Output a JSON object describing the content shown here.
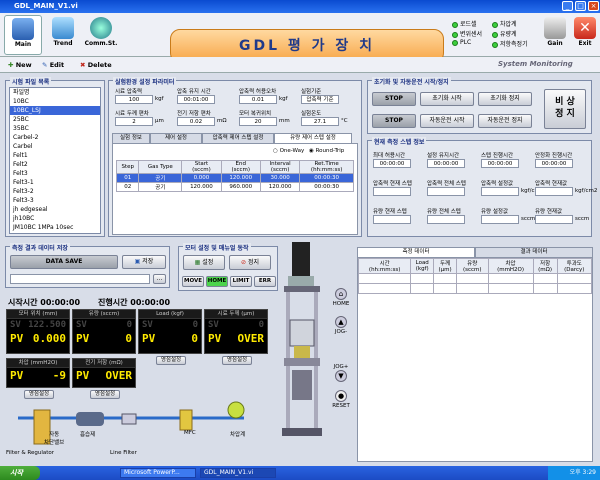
{
  "window": {
    "title": "GDL_MAIN_V1.vi"
  },
  "toolbar": {
    "main": "Main",
    "trend": "Trend",
    "comm": "Comm.St.",
    "gain": "Gain",
    "exit": "Exit",
    "banner": "GDL 평 가 장 치",
    "leds": [
      "로드셀",
      "변위센서",
      "PLC",
      "차압계",
      "유량계",
      "저항측정기"
    ]
  },
  "actions": {
    "new": "New",
    "edit": "Edit",
    "delete": "Delete",
    "system_monitoring": "System Monitoring"
  },
  "sample_list": {
    "title": "시험 파일 목록",
    "items": [
      "파일명",
      "10BC",
      "10BC_LSJ",
      "25BC",
      "35BC",
      "Carbel-2",
      "Carbel",
      "Felt1",
      "Felt2",
      "Felt3",
      "Felt3-1",
      "Felt3-2",
      "Felt3-3",
      "jh edgeseal",
      "jh10BC",
      "JM10BC 1MPa 10sec"
    ],
    "selected": 2
  },
  "params": {
    "title": "실험환경 설정 파라미터",
    "row1": [
      {
        "label": "시료 압축력",
        "value": "100",
        "unit": "kgf"
      },
      {
        "label": "압축 유지 시간",
        "value": "00:01:00",
        "unit": ""
      },
      {
        "label": "압축력 허용오차",
        "value": "0.01",
        "unit": "kgf"
      },
      {
        "label": "실험기준",
        "value": "압축력 기준",
        "unit": ""
      }
    ],
    "row2": [
      {
        "label": "시료 두께 편차",
        "value": "2",
        "unit": "μm"
      },
      {
        "label": "전기 저항 편차",
        "value": "0.02",
        "unit": "mΩ"
      },
      {
        "label": "모터 복귀위치",
        "value": "20",
        "unit": "mm"
      },
      {
        "label": "실험온도",
        "value": "27.1",
        "unit": "°C"
      }
    ],
    "tabs": [
      "실험 정보",
      "제어 설정",
      "압축력 제어 스텝 설정",
      "유량 제어 스텝 설정"
    ],
    "radio": [
      "One-Way",
      "Round-Trip"
    ],
    "columns": [
      "Step",
      "Gas Type",
      "Start\n(sccm)",
      "End\n(sccm)",
      "Interval\n(sccm)",
      "Ret.Time\n(hh:mm:ss)"
    ],
    "rows": [
      [
        "01",
        "공기",
        "0.000",
        "120.000",
        "30.000",
        "00:00:30"
      ],
      [
        "02",
        "공기",
        "120.000",
        "960.000",
        "120.000",
        "00:00:30"
      ]
    ]
  },
  "control": {
    "title": "초기화 및 자동운전 시작/정지",
    "stop": "STOP",
    "init_start": "초기화 시작",
    "init_stop": "초기화 정지",
    "auto_start": "자동운전 시작",
    "auto_stop": "자동운전 정지",
    "emergency": "비 상\n정 지"
  },
  "status": {
    "title": "현재 측정 스텝 정보",
    "row1": [
      {
        "label": "최대 허용시간",
        "value": "00:00:00"
      },
      {
        "label": "설정 유지시간",
        "value": "00:00:00"
      },
      {
        "label": "스텝 진행시간",
        "value": "00:00:00"
      },
      {
        "label": "안정화 진행시간",
        "value": "00:00:00"
      }
    ],
    "row2": [
      {
        "label": "압축력 현재 스텝"
      },
      {
        "label": "압축력 전체 스텝"
      },
      {
        "label": "압축력 설정값",
        "unit": "kgf/cm2"
      },
      {
        "label": "압축력 현재값",
        "unit": "kgf/cm2"
      }
    ],
    "row3": [
      {
        "label": "유량 현재 스텝"
      },
      {
        "label": "유량 전체 스텝"
      },
      {
        "label": "유량 설정값",
        "unit": "sccm"
      },
      {
        "label": "유량 현재값",
        "unit": "sccm"
      }
    ]
  },
  "save": {
    "title": "측정 결과 데이터 저장",
    "data_save": "DATA SAVE",
    "store": "저장",
    "browse": "..."
  },
  "motor": {
    "title": "모터 설정 및 매뉴얼 동작",
    "set": "설정",
    "stop": "정지",
    "modes": [
      "MOVE",
      "HOME",
      "LIMIT",
      "ERR"
    ]
  },
  "manual": {
    "home": "HOME",
    "jog_minus": "JOG-",
    "jog_plus": "JOG+",
    "reset": "RESET"
  },
  "timers": {
    "start_label": "시작시간",
    "start": "00:00:00",
    "elapsed_label": "진행시간",
    "elapsed": "00:00:00"
  },
  "meters": [
    {
      "title": "모터 위치 (mm)",
      "sv_label": "SV",
      "sv": "122.500",
      "pv_label": "PV",
      "pv": "0.000"
    },
    {
      "title": "유량 (sccm)",
      "sv_label": "SV",
      "sv": "0",
      "pv_label": "PV",
      "pv": "0"
    },
    {
      "title": "Load (kgf)",
      "sv_label": "SV",
      "sv": "0",
      "pv_label": "PV",
      "pv": "0",
      "btn": "영점설정"
    },
    {
      "title": "시료 두께 (μm)",
      "sv_label": "SV",
      "sv": "0",
      "pv_label": "PV",
      "pv": "OVER",
      "btn": "영점설정"
    },
    {
      "title": "차압 (mmH2O)",
      "pv_label": "PV",
      "pv": "-9",
      "btn": "영점설정"
    },
    {
      "title": "전기 저항 (mΩ)",
      "pv_label": "PV",
      "pv": "OVER",
      "btn": "영점설정"
    }
  ],
  "schematic": {
    "filter": "Filter & Regulator",
    "valve": "자동\n차단밸브",
    "tank": "흡습제",
    "linefilter": "Line Filter",
    "mfc": "MFC",
    "gauge": "차압계"
  },
  "data_tabs": [
    "측정 데이터",
    "결과 데이터"
  ],
  "data_columns": [
    "시간\n(hh:mm:ss)",
    "Load\n(kgf)",
    "두께\n(μm)",
    "유량\n(sccm)",
    "차압\n(mmH2O)",
    "저항\n(mΩ)",
    "투과도\n(Darcy)"
  ],
  "taskbar": {
    "start": "시작",
    "tasks": [
      "Microsoft PowerP...",
      "GDL_MAIN_V1.vi"
    ],
    "clock": "오후 3:29"
  },
  "colors": {
    "titlebar": "#0a4bd0",
    "banner": "#f7a546",
    "pv": "#ffea00",
    "led": "#3ccd3c"
  }
}
